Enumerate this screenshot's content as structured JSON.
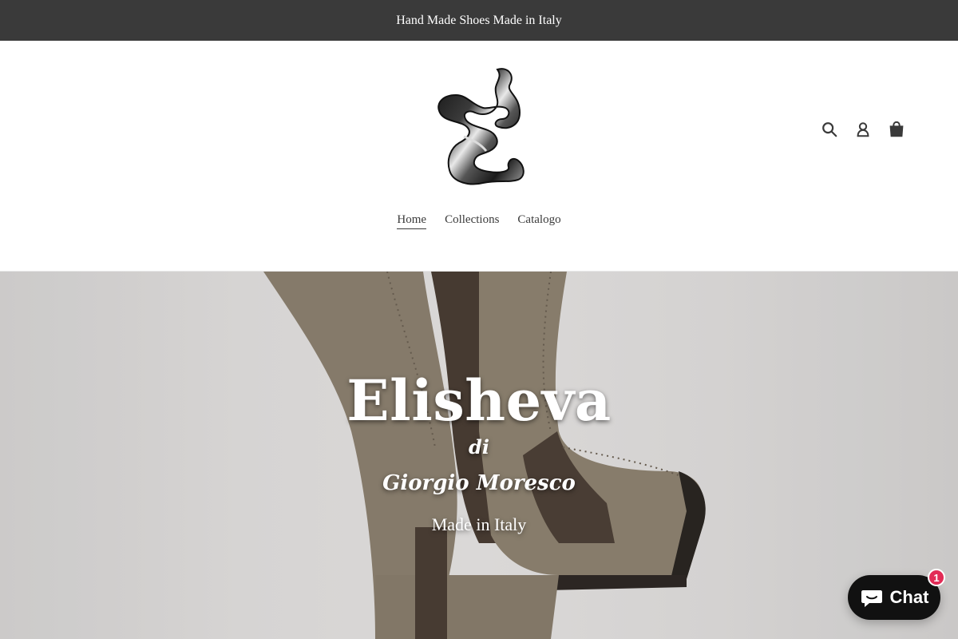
{
  "announcement": {
    "text": "Hand Made Shoes Made in Italy"
  },
  "header": {
    "logo_icon": "brand-e-logo",
    "icons": {
      "search": "search-icon",
      "account": "account-icon",
      "cart": "cart-icon"
    }
  },
  "nav": {
    "items": [
      {
        "label": "Home",
        "active": true
      },
      {
        "label": "Collections",
        "active": false
      },
      {
        "label": "Catalogo",
        "active": false
      }
    ]
  },
  "hero": {
    "title": "Elisheva",
    "di": "di",
    "name": "Giorgio Moresco",
    "subtitle": "Made in Italy"
  },
  "chat": {
    "label": "Chat",
    "badge": "1",
    "icon": "chat-bubble-icon"
  },
  "colors": {
    "announcement_bg": "#3a3a3a",
    "text": "#3a3a3a",
    "chat_bg": "#111111",
    "badge": "#e22b56"
  }
}
